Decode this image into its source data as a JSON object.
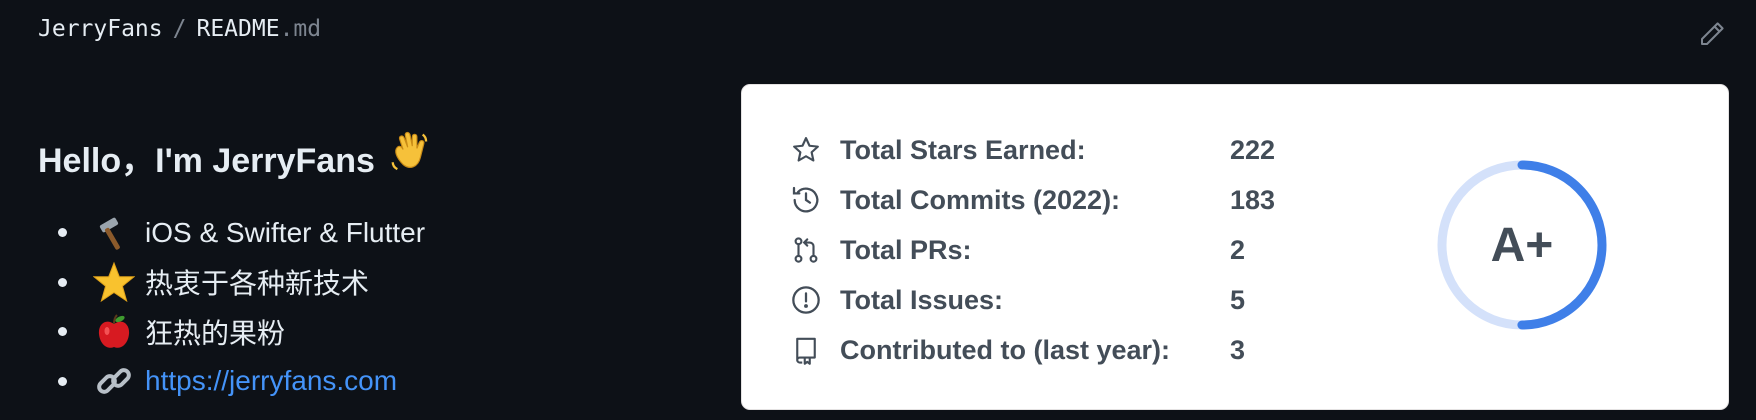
{
  "breadcrumb": {
    "owner": "JerryFans",
    "separator": "/",
    "file_name": "README",
    "file_ext": ".md"
  },
  "readme": {
    "heading": "Hello，I'm JerryFans",
    "heading_emoji": "waving-hand-icon",
    "bullets": [
      {
        "icon": "hammer-icon",
        "text": "iOS & Swifter & Flutter"
      },
      {
        "icon": "star-icon",
        "text": "热衷于各种新技术"
      },
      {
        "icon": "apple-icon",
        "text": "狂热的果粉"
      },
      {
        "icon": "link-icon",
        "text": "https://jerryfans.com",
        "link": true
      }
    ]
  },
  "stats_card": {
    "rows": [
      {
        "icon": "star-outline-icon",
        "label": "Total Stars Earned:",
        "value": "222"
      },
      {
        "icon": "history-icon",
        "label": "Total Commits (2022):",
        "value": "183"
      },
      {
        "icon": "pull-request-icon",
        "label": "Total PRs:",
        "value": "2"
      },
      {
        "icon": "issue-icon",
        "label": "Total Issues:",
        "value": "5"
      },
      {
        "icon": "repo-icon",
        "label": "Contributed to (last year):",
        "value": "3"
      }
    ],
    "rank": "A+",
    "rank_progress": 0.5,
    "colors": {
      "ring_fill": "#3f7fe8",
      "ring_track": "#d4e1fa",
      "text": "#434d58"
    }
  },
  "colors": {
    "background": "#0d1117",
    "link": "#4493f8",
    "text": "#e6edf3",
    "muted": "#7d8590"
  }
}
